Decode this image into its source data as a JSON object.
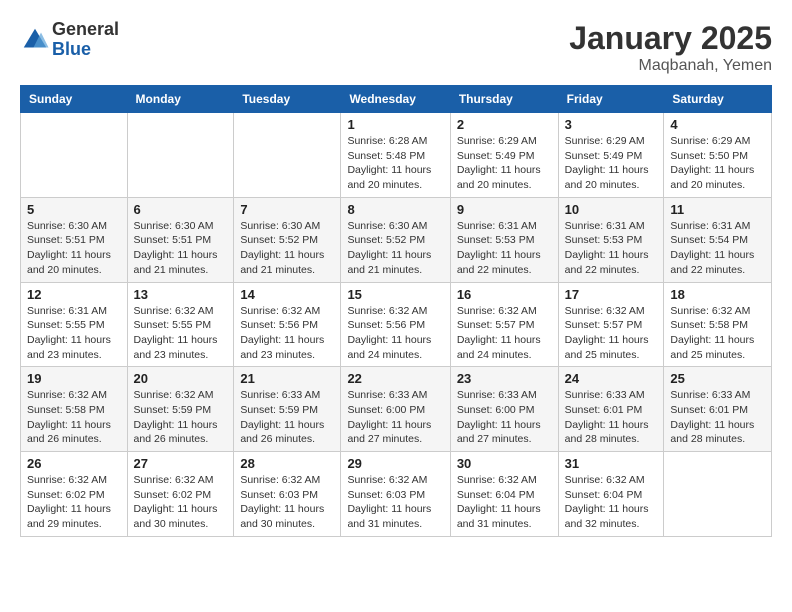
{
  "logo": {
    "general": "General",
    "blue": "Blue"
  },
  "title": "January 2025",
  "location": "Maqbanah, Yemen",
  "days_of_week": [
    "Sunday",
    "Monday",
    "Tuesday",
    "Wednesday",
    "Thursday",
    "Friday",
    "Saturday"
  ],
  "weeks": [
    [
      {
        "day": "",
        "info": ""
      },
      {
        "day": "",
        "info": ""
      },
      {
        "day": "",
        "info": ""
      },
      {
        "day": "1",
        "info": "Sunrise: 6:28 AM\nSunset: 5:48 PM\nDaylight: 11 hours and 20 minutes."
      },
      {
        "day": "2",
        "info": "Sunrise: 6:29 AM\nSunset: 5:49 PM\nDaylight: 11 hours and 20 minutes."
      },
      {
        "day": "3",
        "info": "Sunrise: 6:29 AM\nSunset: 5:49 PM\nDaylight: 11 hours and 20 minutes."
      },
      {
        "day": "4",
        "info": "Sunrise: 6:29 AM\nSunset: 5:50 PM\nDaylight: 11 hours and 20 minutes."
      }
    ],
    [
      {
        "day": "5",
        "info": "Sunrise: 6:30 AM\nSunset: 5:51 PM\nDaylight: 11 hours and 20 minutes."
      },
      {
        "day": "6",
        "info": "Sunrise: 6:30 AM\nSunset: 5:51 PM\nDaylight: 11 hours and 21 minutes."
      },
      {
        "day": "7",
        "info": "Sunrise: 6:30 AM\nSunset: 5:52 PM\nDaylight: 11 hours and 21 minutes."
      },
      {
        "day": "8",
        "info": "Sunrise: 6:30 AM\nSunset: 5:52 PM\nDaylight: 11 hours and 21 minutes."
      },
      {
        "day": "9",
        "info": "Sunrise: 6:31 AM\nSunset: 5:53 PM\nDaylight: 11 hours and 22 minutes."
      },
      {
        "day": "10",
        "info": "Sunrise: 6:31 AM\nSunset: 5:53 PM\nDaylight: 11 hours and 22 minutes."
      },
      {
        "day": "11",
        "info": "Sunrise: 6:31 AM\nSunset: 5:54 PM\nDaylight: 11 hours and 22 minutes."
      }
    ],
    [
      {
        "day": "12",
        "info": "Sunrise: 6:31 AM\nSunset: 5:55 PM\nDaylight: 11 hours and 23 minutes."
      },
      {
        "day": "13",
        "info": "Sunrise: 6:32 AM\nSunset: 5:55 PM\nDaylight: 11 hours and 23 minutes."
      },
      {
        "day": "14",
        "info": "Sunrise: 6:32 AM\nSunset: 5:56 PM\nDaylight: 11 hours and 23 minutes."
      },
      {
        "day": "15",
        "info": "Sunrise: 6:32 AM\nSunset: 5:56 PM\nDaylight: 11 hours and 24 minutes."
      },
      {
        "day": "16",
        "info": "Sunrise: 6:32 AM\nSunset: 5:57 PM\nDaylight: 11 hours and 24 minutes."
      },
      {
        "day": "17",
        "info": "Sunrise: 6:32 AM\nSunset: 5:57 PM\nDaylight: 11 hours and 25 minutes."
      },
      {
        "day": "18",
        "info": "Sunrise: 6:32 AM\nSunset: 5:58 PM\nDaylight: 11 hours and 25 minutes."
      }
    ],
    [
      {
        "day": "19",
        "info": "Sunrise: 6:32 AM\nSunset: 5:58 PM\nDaylight: 11 hours and 26 minutes."
      },
      {
        "day": "20",
        "info": "Sunrise: 6:32 AM\nSunset: 5:59 PM\nDaylight: 11 hours and 26 minutes."
      },
      {
        "day": "21",
        "info": "Sunrise: 6:33 AM\nSunset: 5:59 PM\nDaylight: 11 hours and 26 minutes."
      },
      {
        "day": "22",
        "info": "Sunrise: 6:33 AM\nSunset: 6:00 PM\nDaylight: 11 hours and 27 minutes."
      },
      {
        "day": "23",
        "info": "Sunrise: 6:33 AM\nSunset: 6:00 PM\nDaylight: 11 hours and 27 minutes."
      },
      {
        "day": "24",
        "info": "Sunrise: 6:33 AM\nSunset: 6:01 PM\nDaylight: 11 hours and 28 minutes."
      },
      {
        "day": "25",
        "info": "Sunrise: 6:33 AM\nSunset: 6:01 PM\nDaylight: 11 hours and 28 minutes."
      }
    ],
    [
      {
        "day": "26",
        "info": "Sunrise: 6:32 AM\nSunset: 6:02 PM\nDaylight: 11 hours and 29 minutes."
      },
      {
        "day": "27",
        "info": "Sunrise: 6:32 AM\nSunset: 6:02 PM\nDaylight: 11 hours and 30 minutes."
      },
      {
        "day": "28",
        "info": "Sunrise: 6:32 AM\nSunset: 6:03 PM\nDaylight: 11 hours and 30 minutes."
      },
      {
        "day": "29",
        "info": "Sunrise: 6:32 AM\nSunset: 6:03 PM\nDaylight: 11 hours and 31 minutes."
      },
      {
        "day": "30",
        "info": "Sunrise: 6:32 AM\nSunset: 6:04 PM\nDaylight: 11 hours and 31 minutes."
      },
      {
        "day": "31",
        "info": "Sunrise: 6:32 AM\nSunset: 6:04 PM\nDaylight: 11 hours and 32 minutes."
      },
      {
        "day": "",
        "info": ""
      }
    ]
  ]
}
